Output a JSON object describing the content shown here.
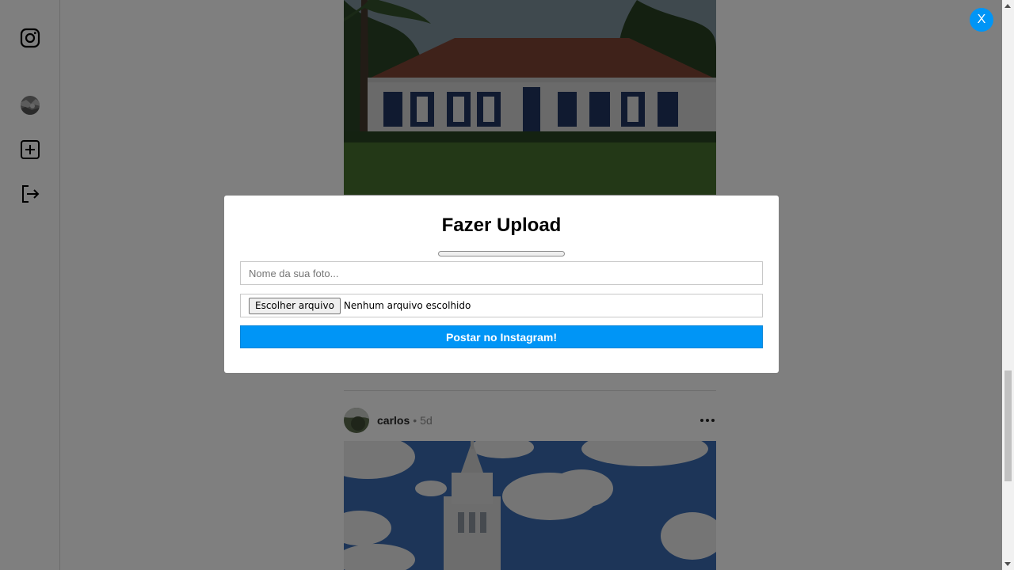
{
  "sidebar": {
    "items": [
      {
        "name": "instagram-logo-icon"
      },
      {
        "name": "profile-avatar"
      },
      {
        "name": "new-post-plus-icon"
      },
      {
        "name": "logout-icon"
      }
    ]
  },
  "feed": {
    "post": {
      "username": "carlos",
      "separator": "•",
      "time": "5d"
    }
  },
  "modal": {
    "close_label": "X",
    "title": "Fazer Upload",
    "upload_progress": 0,
    "name_placeholder": "Nome da sua foto...",
    "file_button_label": "Escolher arquivo",
    "file_status": "Nenhum arquivo escolhido",
    "submit_label": "Postar no Instagram!"
  },
  "colors": {
    "accent": "#0095f6",
    "overlay": "rgba(0,0,0,0.5)"
  }
}
